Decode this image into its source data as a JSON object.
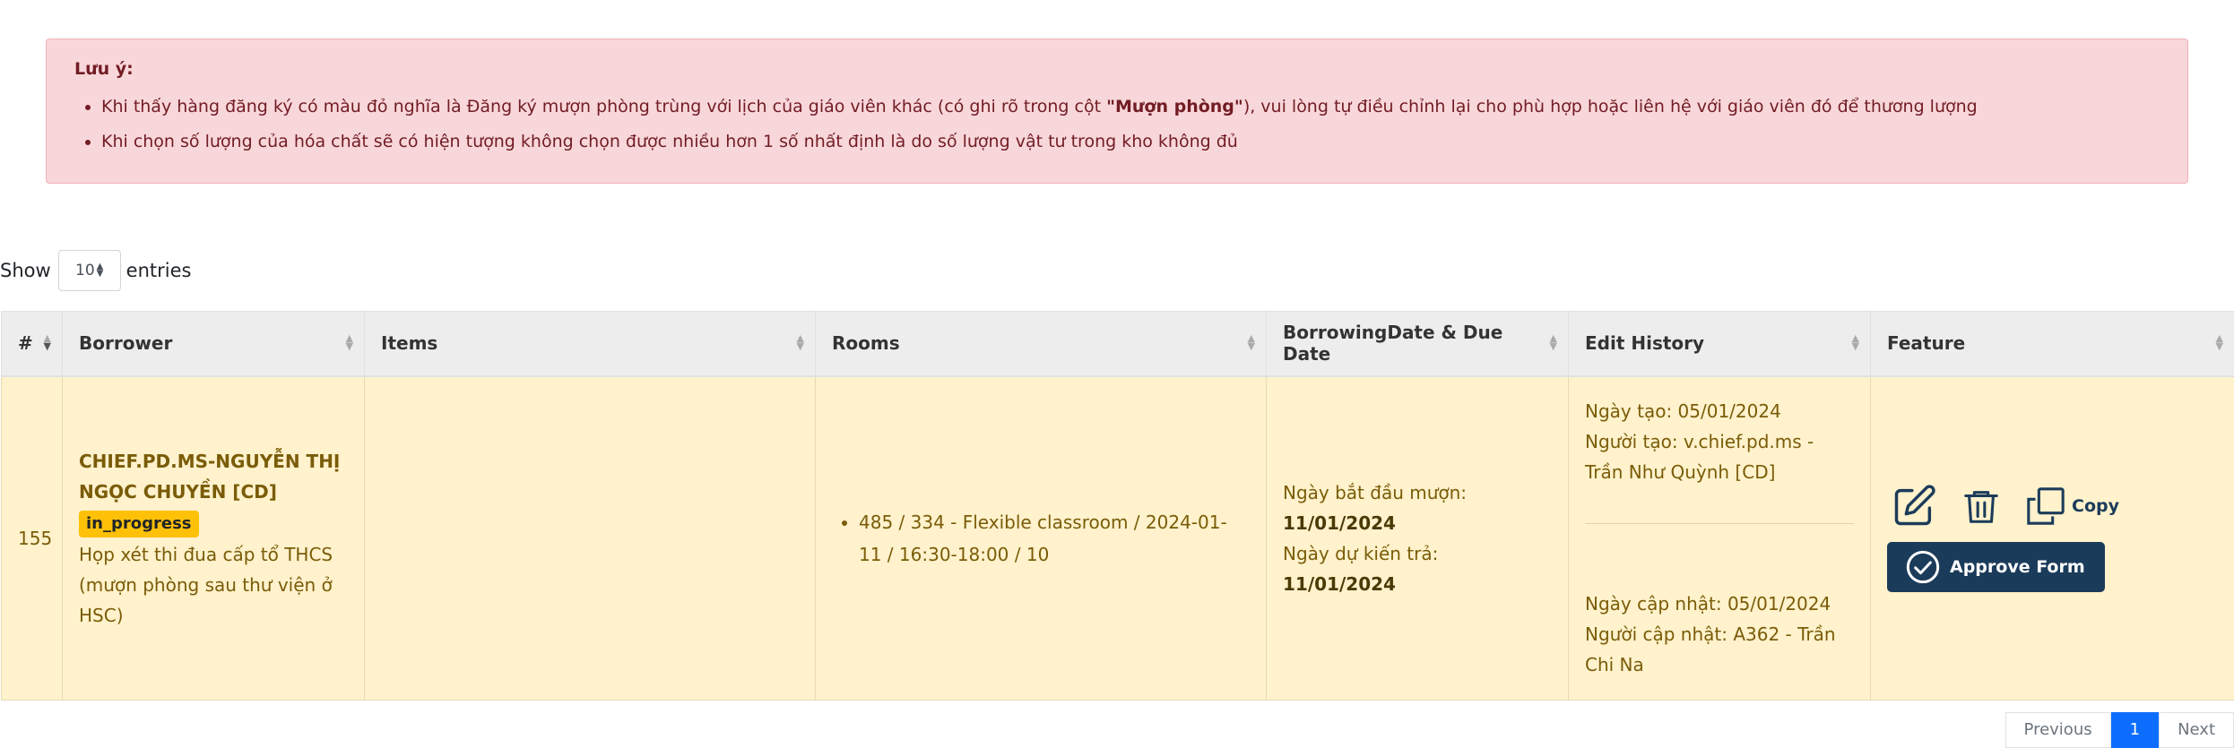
{
  "alert": {
    "title": "Lưu ý:",
    "line1_pre": "Khi thấy hàng đăng ký có màu đỏ nghĩa là Đăng ký mượn phòng trùng với lịch của giáo viên khác (có ghi rõ trong cột ",
    "line1_bold": "\"Mượn phòng\"",
    "line1_post": "), vui lòng tự điều chỉnh lại cho phù hợp hoặc liên hệ với giáo viên đó để thương lượng",
    "line2": "Khi chọn số lượng của hóa chất sẽ có hiện tượng không chọn được nhiều hơn 1 số nhất định là do số lượng vật tư trong kho không đủ"
  },
  "length": {
    "show": "Show",
    "value": "10",
    "entries": "entries"
  },
  "columns": {
    "num": "#",
    "borrower": "Borrower",
    "items": "Items",
    "rooms": "Rooms",
    "dates": "BorrowingDate & Due Date",
    "history": "Edit History",
    "feature": "Feature"
  },
  "row": {
    "num": "155",
    "borrower_name": "CHIEF.PD.MS-NGUYỄN THỊ NGỌC CHUYỀN [CD]",
    "status": "in_progress",
    "purpose": "Họp xét thi đua cấp tổ THCS (mượn phòng sau thư viện ở HSC)",
    "items": "",
    "room": "485 / 334 - Flexible classroom / 2024-01-11 / 16:30-18:00 / 10",
    "start_label": "Ngày bắt đầu mượn: ",
    "start_value": "11/01/2024",
    "due_label": "Ngày dự kiến trả: ",
    "due_value": "11/01/2024",
    "created": "Ngày tạo: 05/01/2024",
    "creator": "Người tạo: v.chief.pd.ms - Trần Như Quỳnh [CD]",
    "updated": "Ngày cập nhật: 05/01/2024",
    "updater": "Người cập nhật: A362 - Trần Chi Na",
    "copy_label": "Copy",
    "approve_label": "Approve Form"
  },
  "pager": {
    "prev": "Previous",
    "current": "1",
    "next": "Next"
  },
  "colors": {
    "alert_bg": "#f8d7da",
    "row_bg": "#fff2cc",
    "badge": "#ffc107",
    "primary_dark": "#1b3b5a"
  }
}
